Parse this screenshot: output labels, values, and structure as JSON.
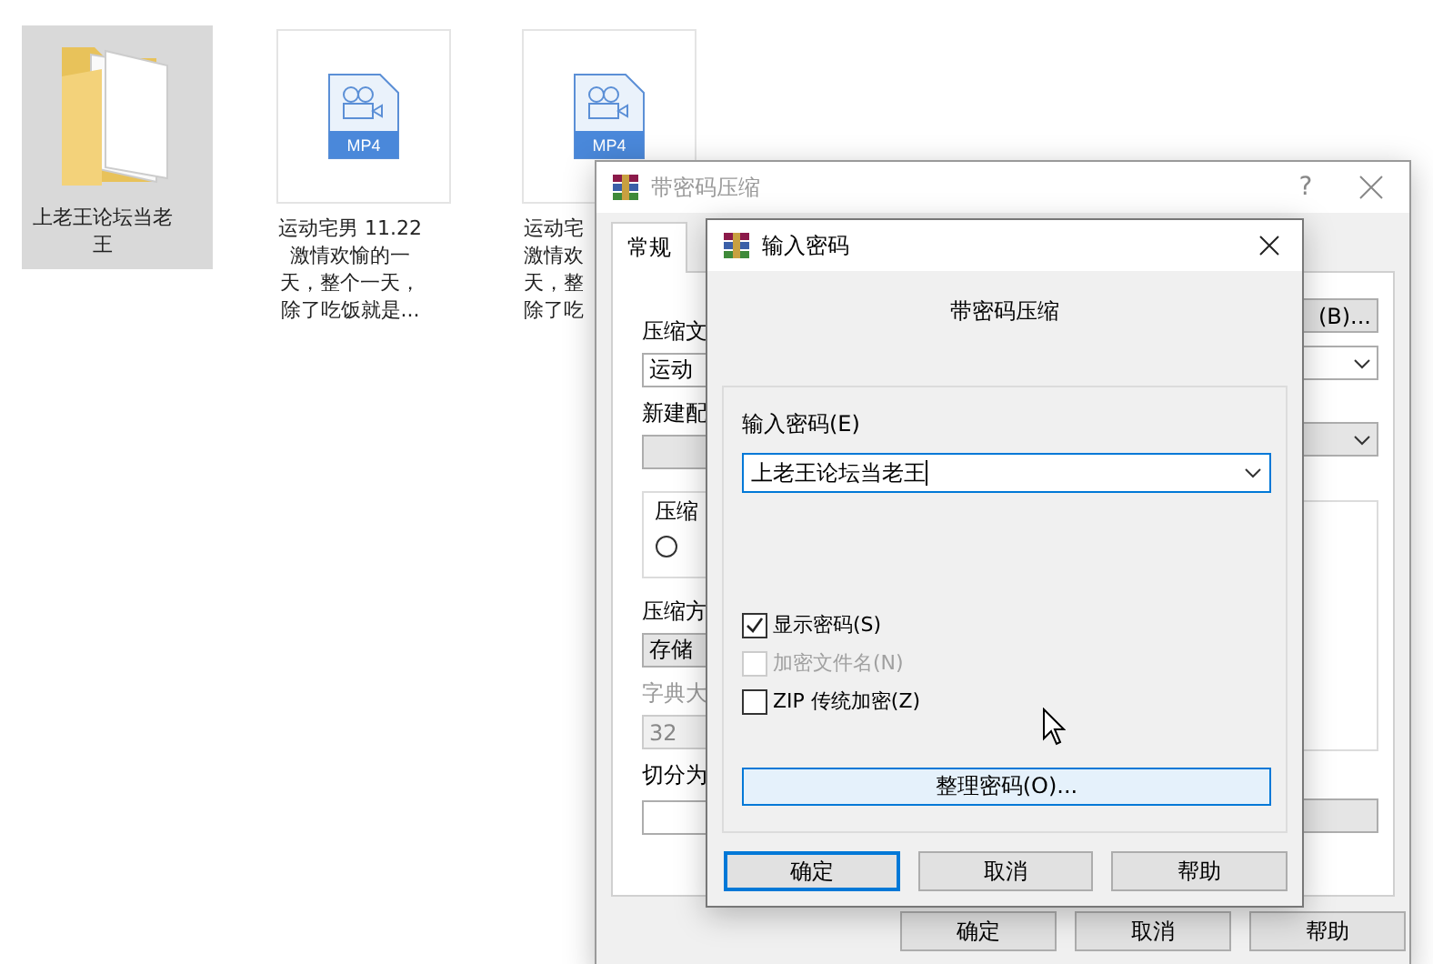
{
  "desktop": {
    "items": [
      {
        "kind": "folder",
        "label_lines": [
          "上老王论坛当老",
          "王"
        ],
        "selected": true
      },
      {
        "kind": "video",
        "badge": "MP4",
        "label_lines": [
          "运动宅男 11.22",
          "激情欢愉的一",
          "天，整个一天，",
          "除了吃饭就是..."
        ],
        "selected": false
      },
      {
        "kind": "video",
        "badge": "MP4",
        "label_lines": [
          "运动宅",
          "激情欢",
          "天，整",
          "除了吃"
        ],
        "selected": false
      }
    ]
  },
  "back_dialog": {
    "title": "带密码压缩",
    "help": "?",
    "tabs": [
      {
        "label": "常规",
        "selected": true
      }
    ],
    "rows": [
      {
        "kind": "label",
        "text": "压缩文"
      },
      {
        "kind": "combo",
        "text": "运动"
      },
      {
        "kind": "label",
        "text": "新建配"
      },
      {
        "kind": "blank-combo"
      },
      {
        "kind": "group",
        "text": "压缩",
        "radio_checked": false
      },
      {
        "kind": "label",
        "text": "压缩方"
      },
      {
        "kind": "select",
        "text": "存储"
      },
      {
        "kind": "disabled-label",
        "text": "字典大"
      },
      {
        "kind": "disabled-field",
        "text": "32"
      },
      {
        "kind": "label",
        "text": "切分为"
      },
      {
        "kind": "blank-field"
      }
    ],
    "browse_button": "(B)...",
    "buttons": [
      "确定",
      "取消",
      "帮助"
    ]
  },
  "password_dialog": {
    "title": "输入密码",
    "heading": "带密码压缩",
    "password_label": "输入密码(E)",
    "password_value": "上老王论坛当老王",
    "options": [
      {
        "label": "显示密码(S)",
        "checked": true,
        "disabled": false
      },
      {
        "label": "加密文件名(N)",
        "checked": false,
        "disabled": true
      },
      {
        "label": "ZIP 传统加密(Z)",
        "checked": false,
        "disabled": false
      }
    ],
    "organize_button": "整理密码(O)...",
    "buttons": [
      {
        "label": "确定",
        "default": true
      },
      {
        "label": "取消",
        "default": false
      },
      {
        "label": "帮助",
        "default": false
      }
    ]
  }
}
